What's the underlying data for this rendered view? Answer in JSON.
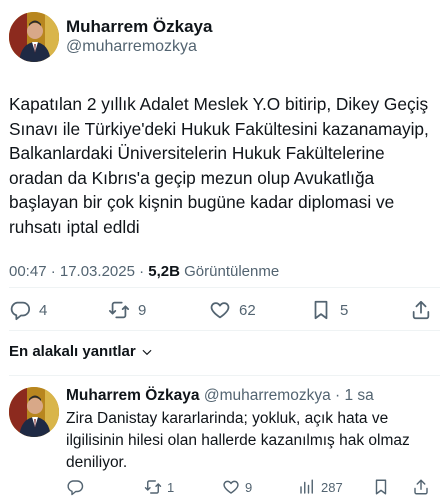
{
  "tweet": {
    "author_name": "Muharrem Özkaya",
    "author_handle": "@muharremozkya",
    "text": "Kapatılan 2 yıllık Adalet Meslek Y.O bitirip, Dikey Geçiş Sınavı ile Türkiye'deki Hukuk Fakültesini kazanamayip, Balkanlardaki Üniversitelerin Hukuk Fakültelerine oradan da Kıbrıs'a geçip mezun olup Avukatlığa başlayan bir çok kişnin bugüne kadar diplomasi ve  ruhsatı iptal edldi",
    "time": "00:47 · 17.03.2025 · ",
    "views_count": "5,2B",
    "views_label": " Görüntülenme",
    "replies": "4",
    "retweets": "9",
    "likes": "62",
    "bookmarks": "5"
  },
  "replies_filter": {
    "label": "En alakalı yanıtlar"
  },
  "reply": {
    "author_name": "Muharrem Özkaya",
    "meta": " @muharremozkya · 1 sa",
    "text": "Zira Danistay kararlarinda; yokluk,  açık hata ve ilgilisinin hilesi olan hallerde kazanılmış hak olmaz deniliyor.",
    "retweets": "1",
    "likes": "9",
    "views": "287"
  },
  "icons": {
    "reply": "reply-icon",
    "retweet": "retweet-icon",
    "like": "heart-icon",
    "bookmark": "bookmark-icon",
    "share": "share-icon",
    "views": "views-icon",
    "chevron": "chevron-down-icon"
  },
  "colors": {
    "text": "#0f1419",
    "secondary": "#536471",
    "divider": "#eff3f4"
  }
}
